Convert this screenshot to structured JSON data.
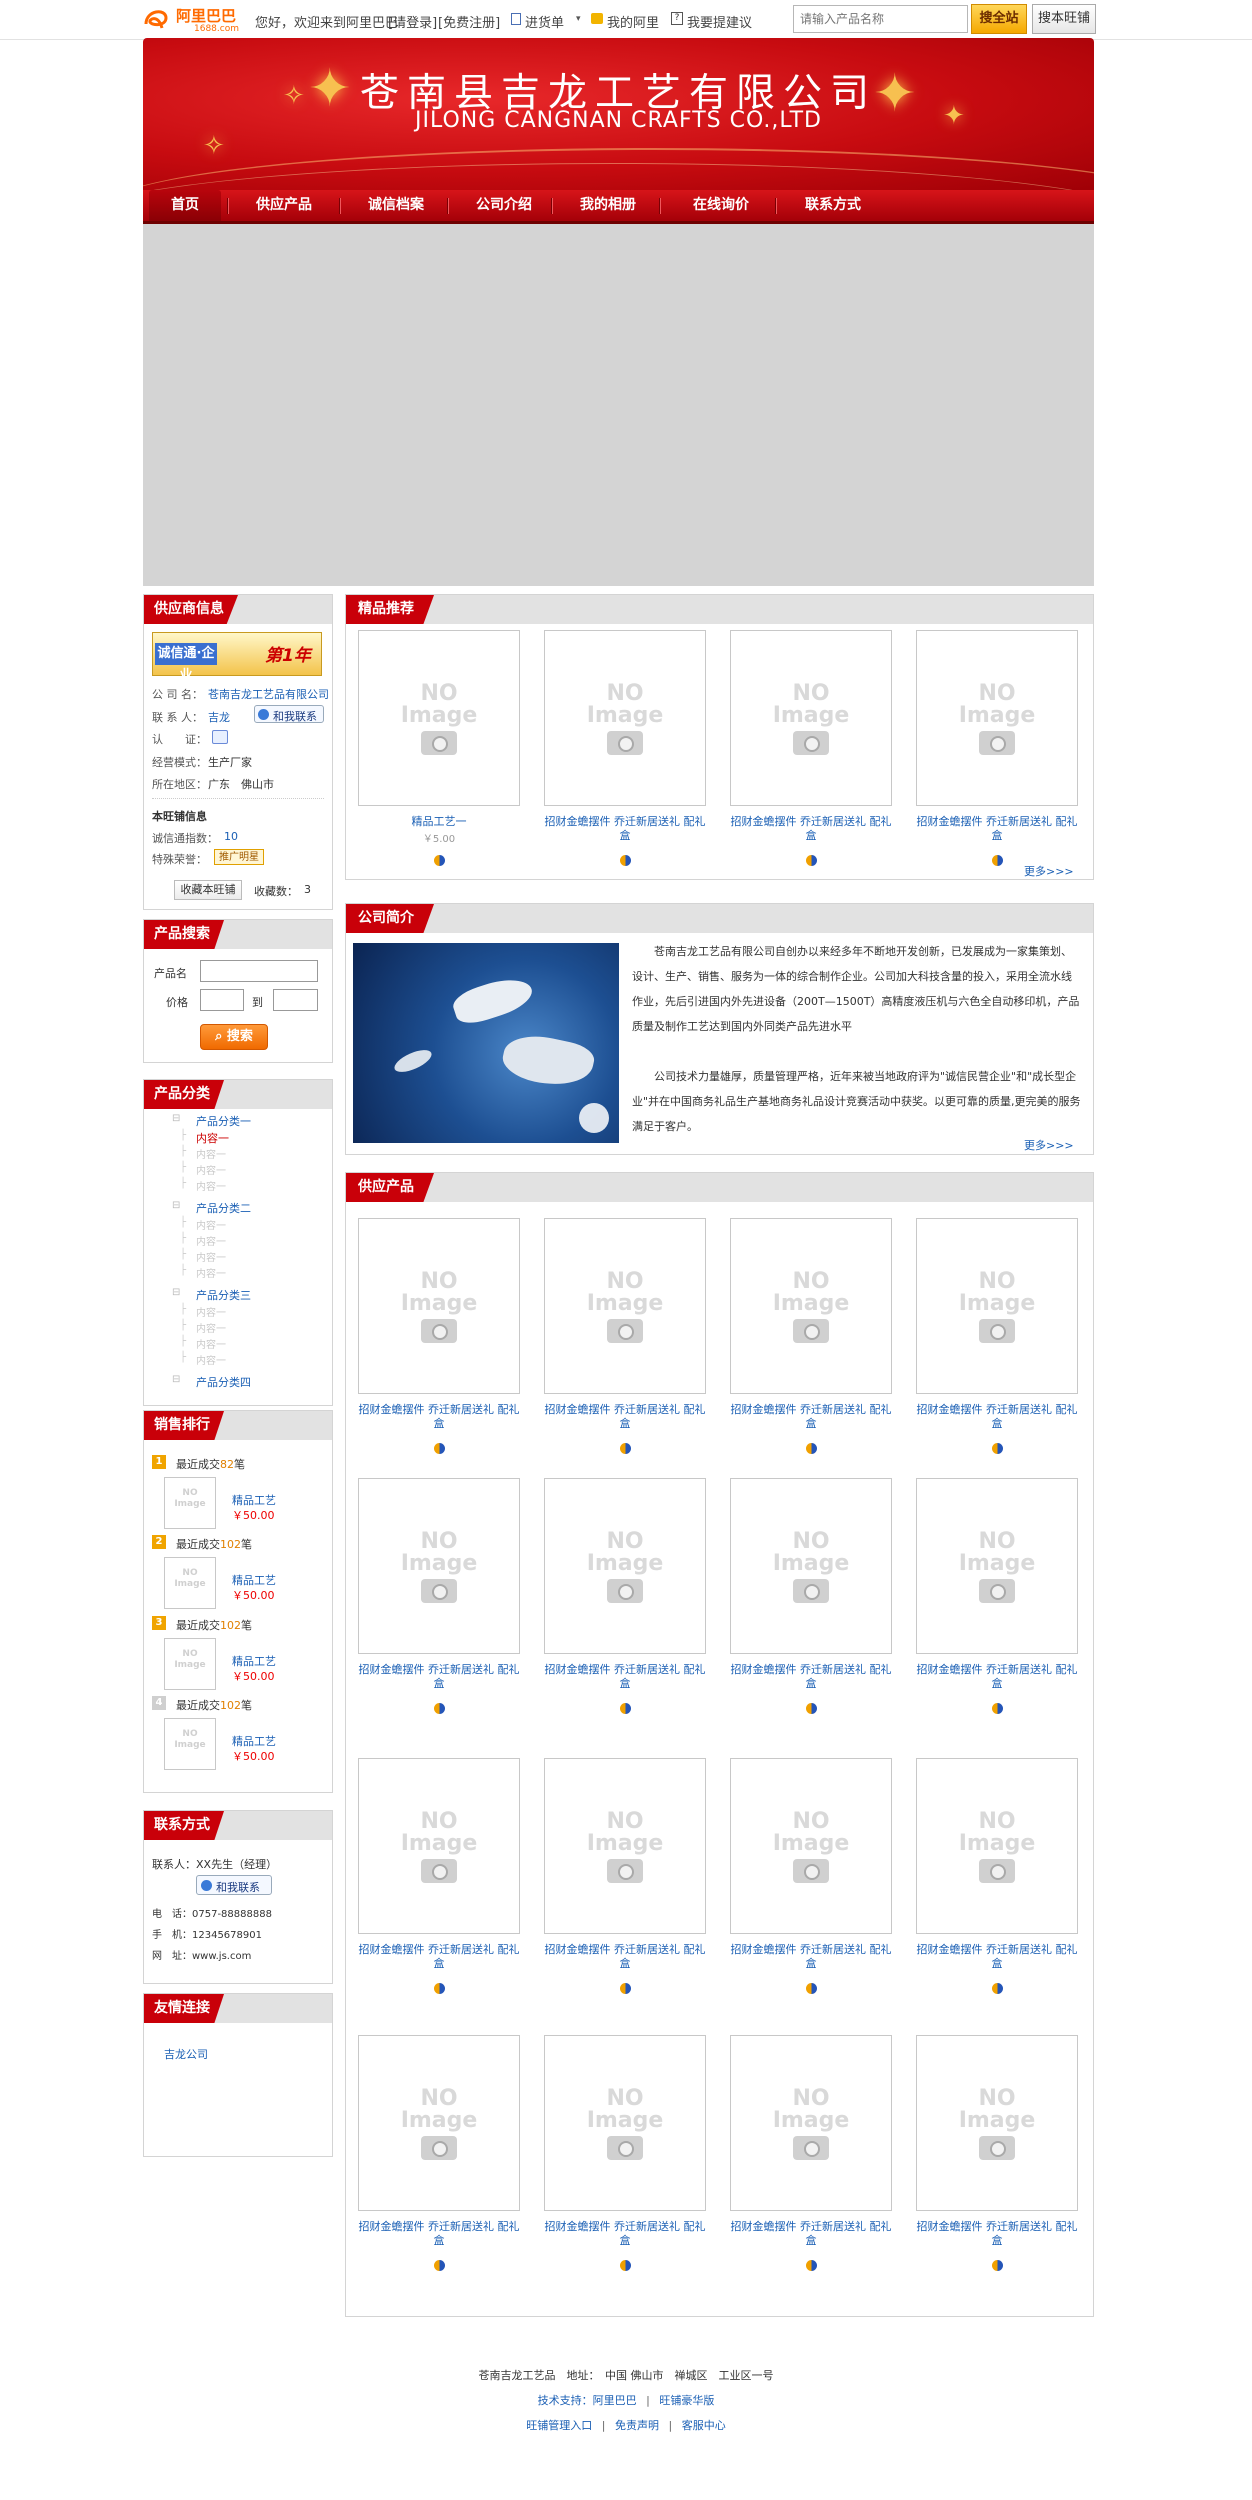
{
  "topbar": {
    "welcome": "您好，欢迎来到阿里巴巴",
    "login": "[请登录]",
    "register": "[免费注册]",
    "cart": "进货单",
    "my_ali": "我的阿里",
    "feedback": "我要提建议",
    "search_placeholder": "请输入产品名称",
    "search_all": "搜全站",
    "search_shop": "搜本旺铺"
  },
  "logo": {
    "text": "阿里巴巴",
    "sub": "1688.com"
  },
  "banner": {
    "title_cn": "苍南县吉龙工艺有限公司",
    "title_en": "JILONG CANGNAN CRAFTS CO.,LTD"
  },
  "nav": [
    "首页",
    "供应产品",
    "诚信档案",
    "公司介绍",
    "我的相册",
    "在线询价",
    "联系方式"
  ],
  "supplier": {
    "heading": "供应商信息",
    "cert_text": "诚信通·企业",
    "cert_year": "第1年",
    "company_label": "公 司 名：",
    "company": "苍南吉龙工艺品有限公司",
    "contact_label": "联 系 人：",
    "contact": "吉龙",
    "talk": "和我联系",
    "verify_label": "认　　证：",
    "model_label": "经营模式：",
    "model": "生产厂家",
    "region_label": "所在地区：",
    "region": "广东　佛山市",
    "shop_title": "本旺铺信息",
    "index_label": "诚信通指数：",
    "index": "10",
    "honor_label": "特殊荣誉：",
    "honor": "推广明星",
    "fav_btn": "收藏本旺铺",
    "fav_label": "收藏数：",
    "fav_count": "3"
  },
  "psearch": {
    "heading": "产品搜索",
    "name_label": "产品名",
    "price_label": "价格",
    "to": "到",
    "btn": "搜索"
  },
  "pcat": {
    "heading": "产品分类",
    "groups": [
      {
        "name": "产品分类一",
        "items": [
          "内容一",
          "内容一",
          "内容一",
          "内容一"
        ]
      },
      {
        "name": "产品分类二",
        "items": [
          "内容一",
          "内容一",
          "内容一",
          "内容一"
        ]
      },
      {
        "name": "产品分类三",
        "items": [
          "内容一",
          "内容一",
          "内容一",
          "内容一"
        ]
      },
      {
        "name": "产品分类四",
        "items": []
      }
    ]
  },
  "sales": {
    "heading": "销售排行",
    "prefix": "最近成交",
    "suffix": "笔",
    "items": [
      {
        "rank": "1",
        "count": "82",
        "name": "精品工艺",
        "price": "￥50.00"
      },
      {
        "rank": "2",
        "count": "102",
        "name": "精品工艺",
        "price": "￥50.00"
      },
      {
        "rank": "3",
        "count": "102",
        "name": "精品工艺",
        "price": "￥50.00"
      },
      {
        "rank": "4",
        "count": "102",
        "name": "精品工艺",
        "price": "￥50.00"
      }
    ]
  },
  "contact": {
    "heading": "联系方式",
    "person": "联系人：XX先生（经理）",
    "talk": "和我联系",
    "phone": "电　话：0757-88888888",
    "mobile": "手　机：12345678901",
    "web": "网　址：www.js.com"
  },
  "links": {
    "heading": "友情连接",
    "items": [
      "吉龙公司"
    ]
  },
  "featured": {
    "heading": "精品推荐",
    "more": "更多>>>",
    "products": [
      {
        "title": "精品工艺一",
        "price": "￥5.00"
      },
      {
        "title": "招财金蟾摆件 乔迁新居送礼 配礼盒",
        "price": ""
      },
      {
        "title": "招财金蟾摆件 乔迁新居送礼 配礼盒",
        "price": ""
      },
      {
        "title": "招财金蟾摆件 乔迁新居送礼 配礼盒",
        "price": ""
      }
    ]
  },
  "intro": {
    "heading": "公司简介",
    "p1": "苍南吉龙工艺品有限公司自创办以来经多年不断地开发创新，已发展成为一家集策划、设计、生产、销售、服务为一体的综合制作企业。公司加大科技含量的投入，采用全流水线作业，先后引进国内外先进设备（200T—1500T）高精度液压机与六色全自动移印机，产品质量及制作工艺达到国内外同类产品先进水平",
    "p2": "公司技术力量雄厚，质量管理严格，近年来被当地政府评为\"诚信民营企业\"和\"成长型企业\"并在中国商务礼品生产基地商务礼品设计竞赛活动中获奖。以更可靠的质量,更完美的服务满足于客户。",
    "more": "更多>>>"
  },
  "supply": {
    "heading": "供应产品",
    "product_title": "招财金蟾摆件 乔迁新居送礼 配礼盒",
    "count": 16
  },
  "noimage": {
    "line1": "NO",
    "line2": "Image"
  },
  "footer": {
    "line1": "苍南吉龙工艺品　地址：　中国 佛山市　禅城区　工业区一号",
    "support": "技术支持：阿里巴巴",
    "sep": "|",
    "wangpu": "旺铺豪华版",
    "admin": "旺铺管理入口",
    "disclaimer": "免责声明",
    "service": "客服中心"
  }
}
